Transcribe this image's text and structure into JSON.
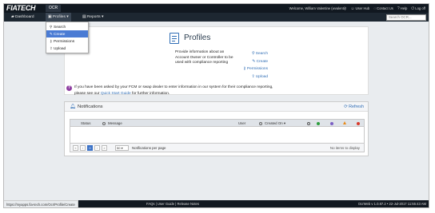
{
  "app": {
    "logo": "FIATECH",
    "name": "OCR"
  },
  "header": {
    "welcome": "Welcome, William Valentine (wvalenti)!",
    "user_hub": "User Hub",
    "contact_us": "Contact Us",
    "help": "Help",
    "log_off": "Log off"
  },
  "nav": {
    "dashboard": "Dashboard",
    "profiles": "Profiles",
    "reports": "Reports",
    "search_placeholder": "Search OCR..."
  },
  "dropdown": {
    "items": [
      {
        "label": "Search",
        "icon": "search-icon"
      },
      {
        "label": "Create",
        "icon": "pencil-icon",
        "selected": true
      },
      {
        "label": "Permissions",
        "icon": "key-icon"
      },
      {
        "label": "Upload",
        "icon": "upload-icon"
      }
    ]
  },
  "profiles_card": {
    "title": "Profiles",
    "description": "Provide information about an Account Owner or Controller to be used with compliance reporting",
    "links": [
      "Search",
      "Create",
      "Permissions",
      "Upload"
    ]
  },
  "info": {
    "line1": "If you have been asked by your FCM or swap dealer to enter information in our system for their compliance reporting,",
    "line2_prefix": "please see our ",
    "line2_link": "Quick Start Guide",
    "line2_suffix": " for further information."
  },
  "notifications": {
    "title": "Notifications",
    "refresh": "Refresh",
    "columns": {
      "status": "Status",
      "message": "Message",
      "user": "User",
      "created_on": "Created On ▾"
    },
    "severity_colors": [
      "#555555",
      "#2e9e3e",
      "#7b5fc4",
      "#e88a1a",
      "#d93a2b"
    ],
    "pager": {
      "first": "«",
      "prev": "‹",
      "current_page": "0",
      "next": "›",
      "last": "»",
      "page_size": "50",
      "page_size_label": "Notifications per page",
      "empty_text": "No items to display"
    }
  },
  "footer": {
    "status_url": "https://myapps.fia-tech.com/Ocr/Profile/Create",
    "links": "FAQs | User Guide | Release Notes",
    "version": "OcrWeb v 1.0.87.2 • 22-Jul-2017 11:55:43 AM"
  },
  "colors": {
    "accent": "#2f6db5",
    "topbar": "#111820",
    "selected": "#4a7bd4",
    "info_icon": "#8e3ea1"
  }
}
